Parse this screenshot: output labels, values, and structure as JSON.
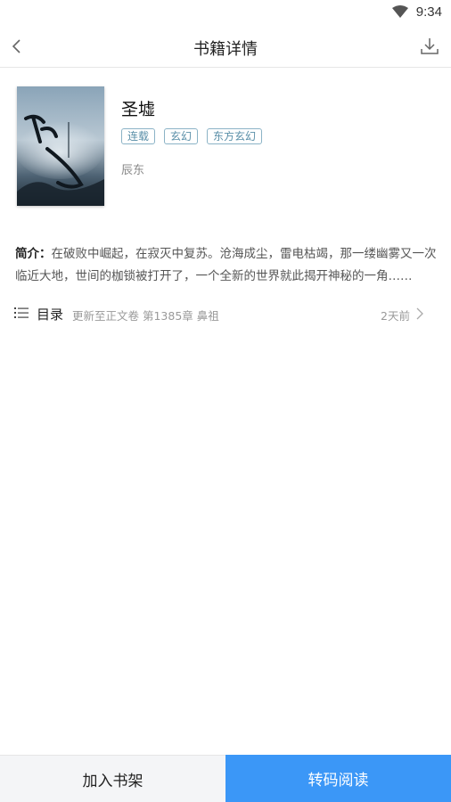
{
  "status_bar": {
    "time": "9:34",
    "wifi_icon": "wifi-icon"
  },
  "nav": {
    "title": "书籍详情",
    "back_icon": "back-arrow-icon",
    "download_icon": "download-icon"
  },
  "book": {
    "title": "圣墟",
    "tags": [
      "连载",
      "玄幻",
      "东方玄幻"
    ],
    "author": "辰东",
    "cover_text": "圣墟",
    "intro_label": "简介：",
    "intro": "在破败中崛起，在寂灭中复苏。沧海成尘，雷电枯竭，那一缕幽雾又一次临近大地，世间的枷锁被打开了，一个全新的世界就此揭开神秘的一角……"
  },
  "catalog": {
    "label": "目录",
    "latest": "更新至正文卷 第1385章 鼻祖",
    "ago": "2天前"
  },
  "actions": {
    "add_shelf": "加入书架",
    "read": "转码阅读"
  },
  "colors": {
    "accent": "#3b97f7",
    "tag": "#5a8fa8"
  }
}
